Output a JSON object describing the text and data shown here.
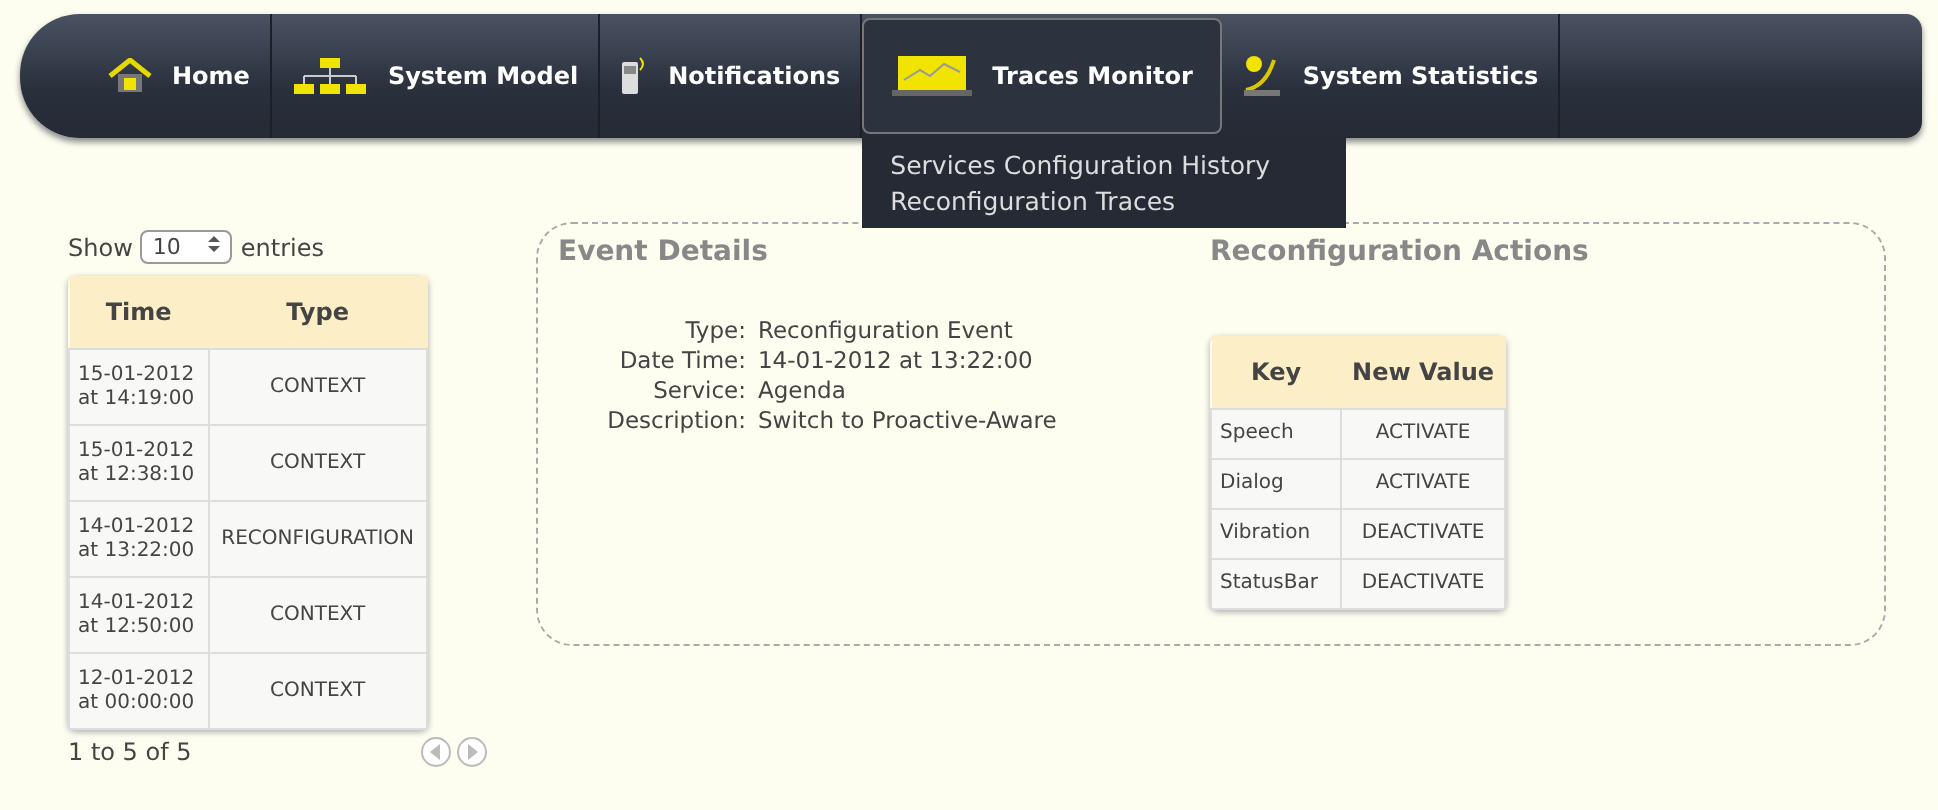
{
  "nav": {
    "items": [
      {
        "label": "Home",
        "selected": false
      },
      {
        "label": "System Model",
        "selected": false
      },
      {
        "label": "Notifications",
        "selected": false
      },
      {
        "label": "Traces Monitor",
        "selected": true,
        "menu": [
          "Services Configuration History",
          "Reconfiguration Traces"
        ]
      },
      {
        "label": "System Statistics",
        "selected": false
      }
    ]
  },
  "list": {
    "show_label": "Show",
    "page_size": "10",
    "entries_label": "entries",
    "columns": [
      "Time",
      "Type"
    ],
    "rows": [
      {
        "time": "15-01-2012\nat 14:19:00",
        "type": "CONTEXT"
      },
      {
        "time": "15-01-2012\nat 12:38:10",
        "type": "CONTEXT"
      },
      {
        "time": "14-01-2012\nat 13:22:00",
        "type": "RECONFIGURATION"
      },
      {
        "time": "14-01-2012\nat 12:50:00",
        "type": "CONTEXT"
      },
      {
        "time": "12-01-2012\nat 00:00:00",
        "type": "CONTEXT"
      }
    ],
    "info": "1 to 5 of 5"
  },
  "event_details": {
    "title": "Event Details",
    "fields": [
      {
        "label": "Type:",
        "value": "Reconfiguration Event"
      },
      {
        "label": "Date Time:",
        "value": "14-01-2012 at 13:22:00"
      },
      {
        "label": "Service:",
        "value": "Agenda"
      },
      {
        "label": "Description:",
        "value": "Switch to Proactive-Aware"
      }
    ]
  },
  "reconfiguration_actions": {
    "title": "Reconfiguration Actions",
    "columns": [
      "Key",
      "New Value"
    ],
    "rows": [
      {
        "key": "Speech",
        "value": "ACTIVATE"
      },
      {
        "key": "Dialog",
        "value": "ACTIVATE"
      },
      {
        "key": "Vibration",
        "value": "DEACTIVATE"
      },
      {
        "key": "StatusBar",
        "value": "DEACTIVATE"
      }
    ]
  }
}
